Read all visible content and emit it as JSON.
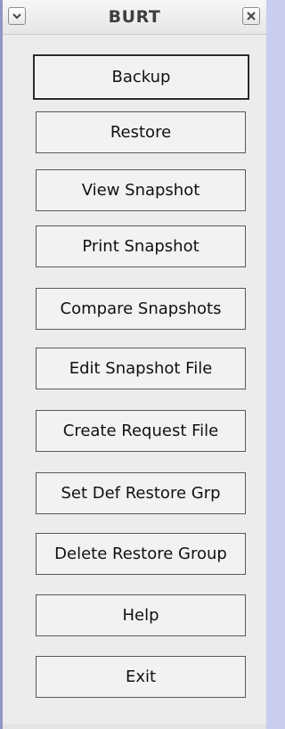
{
  "window": {
    "title": "BURT",
    "menu_icon": "chevron-down-icon",
    "close_icon": "close-icon"
  },
  "buttons": [
    {
      "name": "backup-button",
      "label": "Backup"
    },
    {
      "name": "restore-button",
      "label": "Restore"
    },
    {
      "name": "view-snapshot-button",
      "label": "View Snapshot"
    },
    {
      "name": "print-snapshot-button",
      "label": "Print Snapshot"
    },
    {
      "name": "compare-snapshots-button",
      "label": "Compare Snapshots"
    },
    {
      "name": "edit-snapshot-file-button",
      "label": "Edit Snapshot File"
    },
    {
      "name": "create-request-file-button",
      "label": "Create Request File"
    },
    {
      "name": "set-def-restore-grp-button",
      "label": "Set Def Restore Grp"
    },
    {
      "name": "delete-restore-group-button",
      "label": "Delete Restore Group"
    },
    {
      "name": "help-button",
      "label": "Help"
    },
    {
      "name": "exit-button",
      "label": "Exit"
    }
  ]
}
